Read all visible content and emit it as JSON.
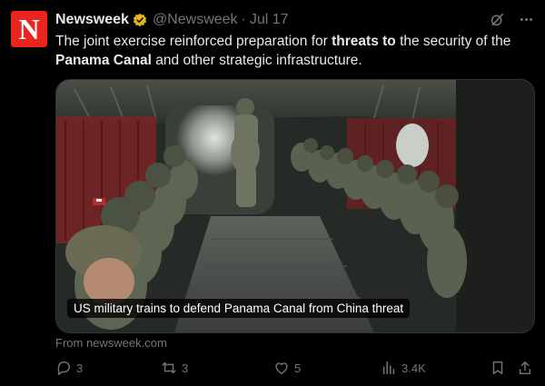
{
  "post": {
    "avatar_letter": "N",
    "display_name": "Newsweek",
    "handle": "@Newsweek",
    "separator": "·",
    "date": "Jul 17",
    "text_parts": [
      {
        "text": "The joint exercise reinforced preparation for ",
        "bold": false
      },
      {
        "text": "threats to",
        "bold": true
      },
      {
        "text": " the security of the ",
        "bold": false
      },
      {
        "text": "Panama Canal",
        "bold": true
      },
      {
        "text": " and other strategic infrastructure.",
        "bold": false
      }
    ]
  },
  "card": {
    "caption": "US military trains to defend Panama Canal from China threat",
    "source": "From newsweek.com"
  },
  "actions": {
    "replies": "3",
    "reposts": "3",
    "likes": "5",
    "views": "3.4K"
  },
  "icons": {
    "verified": "verified-badge-icon",
    "grok": "grok-icon",
    "more": "more-icon",
    "reply": "reply-icon",
    "repost": "repost-icon",
    "like": "like-icon",
    "views": "views-icon",
    "bookmark": "bookmark-icon",
    "share": "share-icon"
  },
  "colors": {
    "brand": "#e8261f",
    "verified": "#e2b719",
    "muted": "#71767b",
    "text": "#e7e9ea"
  }
}
